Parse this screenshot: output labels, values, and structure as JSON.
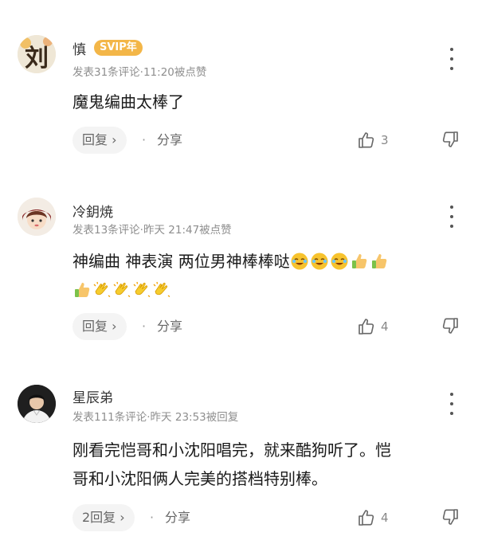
{
  "comments": [
    {
      "username": "慎",
      "badge": "SVIP年",
      "meta": "发表31条评论·11:20被点赞",
      "avatar_text": "刘",
      "text": "魔鬼编曲太棒了",
      "reply_label": "回复 ›",
      "share_label": "分享",
      "like_count": "3"
    },
    {
      "username": "冷鈅焼",
      "meta": "发表13条评论·昨天 21:47被点赞",
      "text": "神编曲 神表演 两位男神棒棒哒",
      "reply_label": "回复 ›",
      "share_label": "分享",
      "like_count": "4"
    },
    {
      "username": "星辰弟",
      "meta": "发表111条评论·昨天 23:53被回复",
      "text_line1": "刚看完恺哥和小沈阳唱完，就来酷狗听了。恺",
      "text_line2": "哥和小沈阳俩人完美的搭档特别棒。",
      "reply_label": "2回复 ›",
      "share_label": "分享",
      "like_count": "4"
    }
  ],
  "colors": {
    "svip": "#f3b648",
    "meta": "#8e8e8e"
  }
}
